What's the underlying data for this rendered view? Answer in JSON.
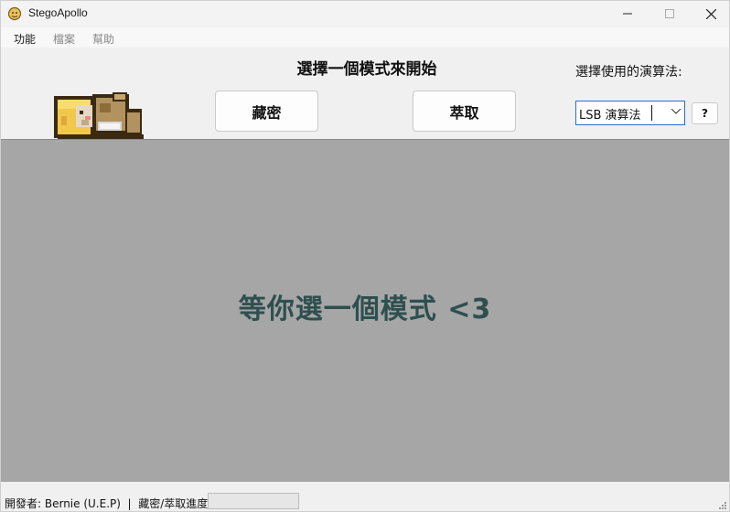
{
  "window": {
    "title": "StegoApollo"
  },
  "menu": {
    "items": [
      "功能",
      "檔案",
      "幫助"
    ]
  },
  "header": {
    "prompt": "選擇一個模式來開始",
    "hide_button": "藏密",
    "extract_button": "萃取",
    "algo_label": "選擇使用的演算法:",
    "algo_selected": "LSB 演算法",
    "help_button": "?"
  },
  "main": {
    "waiting_text": "等你選一個模式 <3"
  },
  "status": {
    "text": "開發者: Bernie (U.E.P)  |  藏密/萃取進度:",
    "progress": 0
  },
  "colors": {
    "main_bg": "#a6a6a6",
    "waiting_text": "#2f4f4f",
    "select_border": "#2a6bd6"
  },
  "icons": [
    "app-icon",
    "minimize-icon",
    "maximize-icon",
    "close-icon",
    "chevron-down-icon",
    "mascot-icon",
    "size-grip-icon"
  ]
}
